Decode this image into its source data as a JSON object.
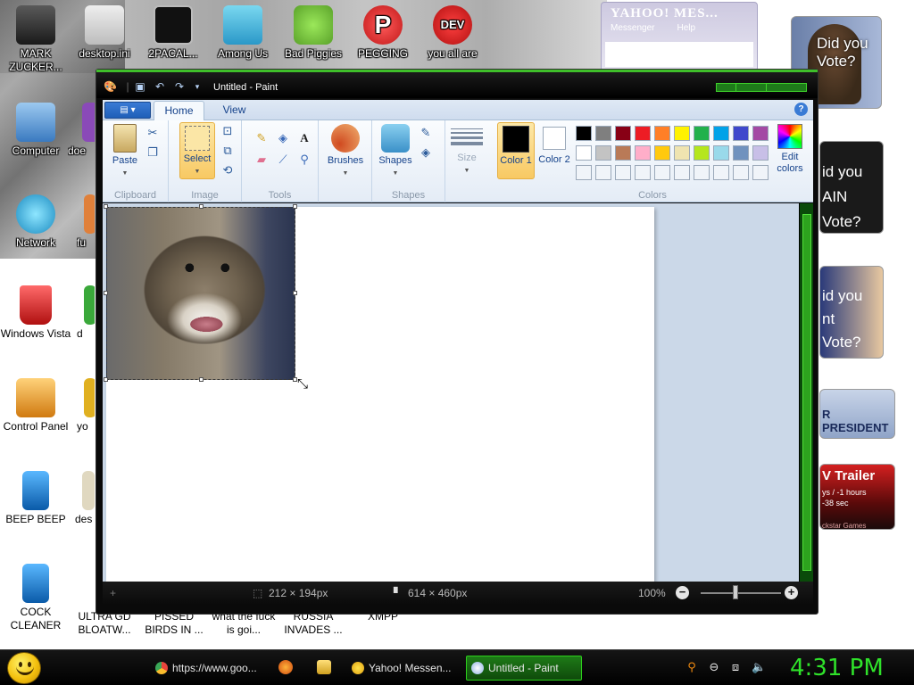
{
  "desktop": {
    "icons": [
      {
        "label": "MARK ZUCKER...",
        "icon": "person-icon",
        "color": "#3a3a3a"
      },
      {
        "label": "desktop.ini",
        "icon": "settings-file-icon",
        "color": "#cfcfcf"
      },
      {
        "label": "2PACAL...",
        "icon": "console-icon",
        "color": "#111111"
      },
      {
        "label": "Among Us",
        "icon": "folder-icon",
        "color": "#48b8d8"
      },
      {
        "label": "Bad Piggies",
        "icon": "pig-icon",
        "color": "#7bc143"
      },
      {
        "label": "PEGGING",
        "icon": "game-p-icon",
        "color": "#d42a2a"
      },
      {
        "label": "you all are",
        "icon": "devcpp-icon",
        "color": "#d31f1f"
      },
      {
        "label": "Computer",
        "icon": "computer-icon",
        "color": "#3a8ad4"
      },
      {
        "label": "doe",
        "icon": "app-icon",
        "color": "#8a4ab8"
      },
      {
        "label": "Network",
        "icon": "globe-icon",
        "color": "#2ab0e0"
      },
      {
        "label": "fu",
        "icon": "app-icon",
        "color": "#e0803a"
      },
      {
        "label": "Windows Vista",
        "icon": "recycle-bin-icon",
        "color": "#d42020"
      },
      {
        "label": "d",
        "icon": "chrome-icon",
        "color": "#3aa83a"
      },
      {
        "label": "Control Panel",
        "icon": "control-panel-icon",
        "color": "#e08a20"
      },
      {
        "label": "yo",
        "icon": "shortcut-icon",
        "color": "#e0b020"
      },
      {
        "label": "BEEP BEEP",
        "icon": "blue-panel-icon",
        "color": "#1a7ad4"
      },
      {
        "label": "des",
        "icon": "shortcut-icon",
        "color": "#e0d8c0"
      },
      {
        "label": "COCK CLEANER",
        "icon": "blue-panel-icon",
        "color": "#1a7ad4"
      },
      {
        "label": "ULTRA GD BLOATW...",
        "icon": "app-icon",
        "color": "#888888"
      },
      {
        "label": "PISSED BIRDS IN ...",
        "icon": "app-icon",
        "color": "#cccccc"
      },
      {
        "label": "what the fuck is goi...",
        "icon": "app-icon",
        "color": "#cccccc"
      },
      {
        "label": "RUSSIA INVADES ...",
        "icon": "app-icon",
        "color": "#cccccc"
      },
      {
        "label": "XMPP",
        "icon": "app-icon",
        "color": "#cccccc"
      }
    ]
  },
  "yahoo_widget": {
    "title": "YAHOO! MES...",
    "menu": [
      "Messenger",
      "Help"
    ]
  },
  "right_badges": [
    {
      "text": "Did you Vote?",
      "name": "obama-did-you-vote"
    },
    {
      "text": "id you AIN Vote?",
      "name": "mccain-did-you-vote"
    },
    {
      "text": "id you nt Vote?",
      "name": "clinton-did-you-vote"
    },
    {
      "text": "R PRESIDENT",
      "name": "president-badge"
    },
    {
      "text": "V Trailer",
      "sub1": "ys / -1 hours",
      "sub2": "-38 sec",
      "sub3": "ckstar Games",
      "name": "trailer-badge"
    }
  ],
  "paint": {
    "title": "Untitled - Paint",
    "tabs": [
      "Home",
      "View"
    ],
    "groups": {
      "clipboard": {
        "label": "Clipboard",
        "paste": "Paste"
      },
      "image": {
        "label": "Image",
        "select": "Select"
      },
      "tools": {
        "label": "Tools"
      },
      "brushes": {
        "label": "Brushes"
      },
      "shapes": {
        "label": "Shapes",
        "shapes_btn": "Shapes"
      },
      "size": {
        "label": "Size"
      },
      "colors": {
        "label": "Colors",
        "color1": "Color 1",
        "color2": "Color 2",
        "edit": "Edit colors"
      }
    },
    "palette_row1": [
      "#000000",
      "#7f7f7f",
      "#880015",
      "#ed1c24",
      "#ff7f27",
      "#fff200",
      "#22b14c",
      "#00a2e8",
      "#3f48cc",
      "#a349a4"
    ],
    "palette_row2": [
      "#ffffff",
      "#c3c3c3",
      "#b97a57",
      "#ffaec9",
      "#ffc90e",
      "#efe4b0",
      "#b5e61d",
      "#99d9ea",
      "#7092be",
      "#c8bfe7"
    ],
    "color1_value": "#000000",
    "color2_value": "#ffffff",
    "status": {
      "selection_size": "212 × 194px",
      "canvas_size": "614 × 460px",
      "zoom": "100%"
    },
    "accent": "#3fbf2a"
  },
  "taskbar": {
    "tasks": [
      {
        "label": "https://www.goo...",
        "icon": "chrome-icon"
      },
      {
        "label": "Yahoo! Messen...",
        "icon": "yahoo-messenger-icon"
      },
      {
        "label": "Untitled - Paint",
        "icon": "paint-icon"
      }
    ],
    "clock": "4:31 PM"
  }
}
